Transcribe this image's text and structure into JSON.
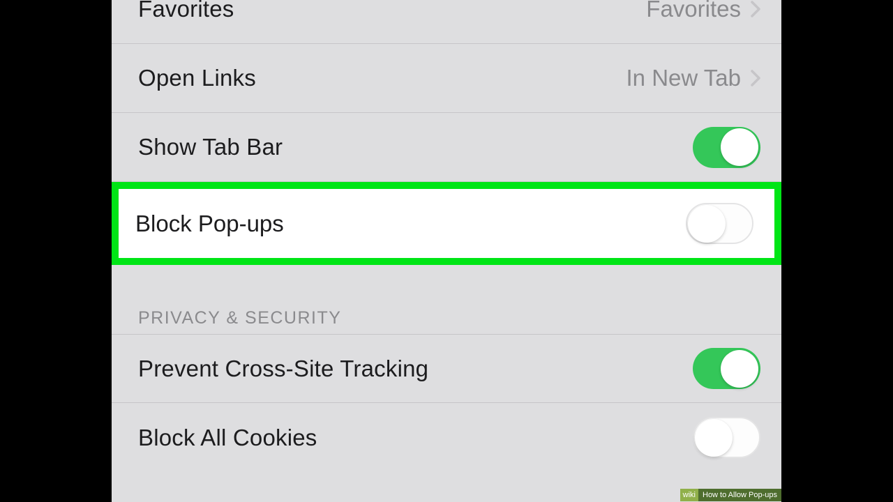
{
  "general": {
    "favorites": {
      "label": "Favorites",
      "value": "Favorites"
    },
    "open_links": {
      "label": "Open Links",
      "value": "In New Tab"
    },
    "show_tab_bar": {
      "label": "Show Tab Bar",
      "on": true
    },
    "block_popups": {
      "label": "Block Pop-ups",
      "on": false
    }
  },
  "privacy": {
    "header": "PRIVACY & SECURITY",
    "prevent_tracking": {
      "label": "Prevent Cross-Site Tracking",
      "on": true
    },
    "block_cookies": {
      "label": "Block All Cookies",
      "on": false
    }
  },
  "watermark": {
    "brand": "wiki",
    "title": "How to Allow Pop-ups"
  }
}
